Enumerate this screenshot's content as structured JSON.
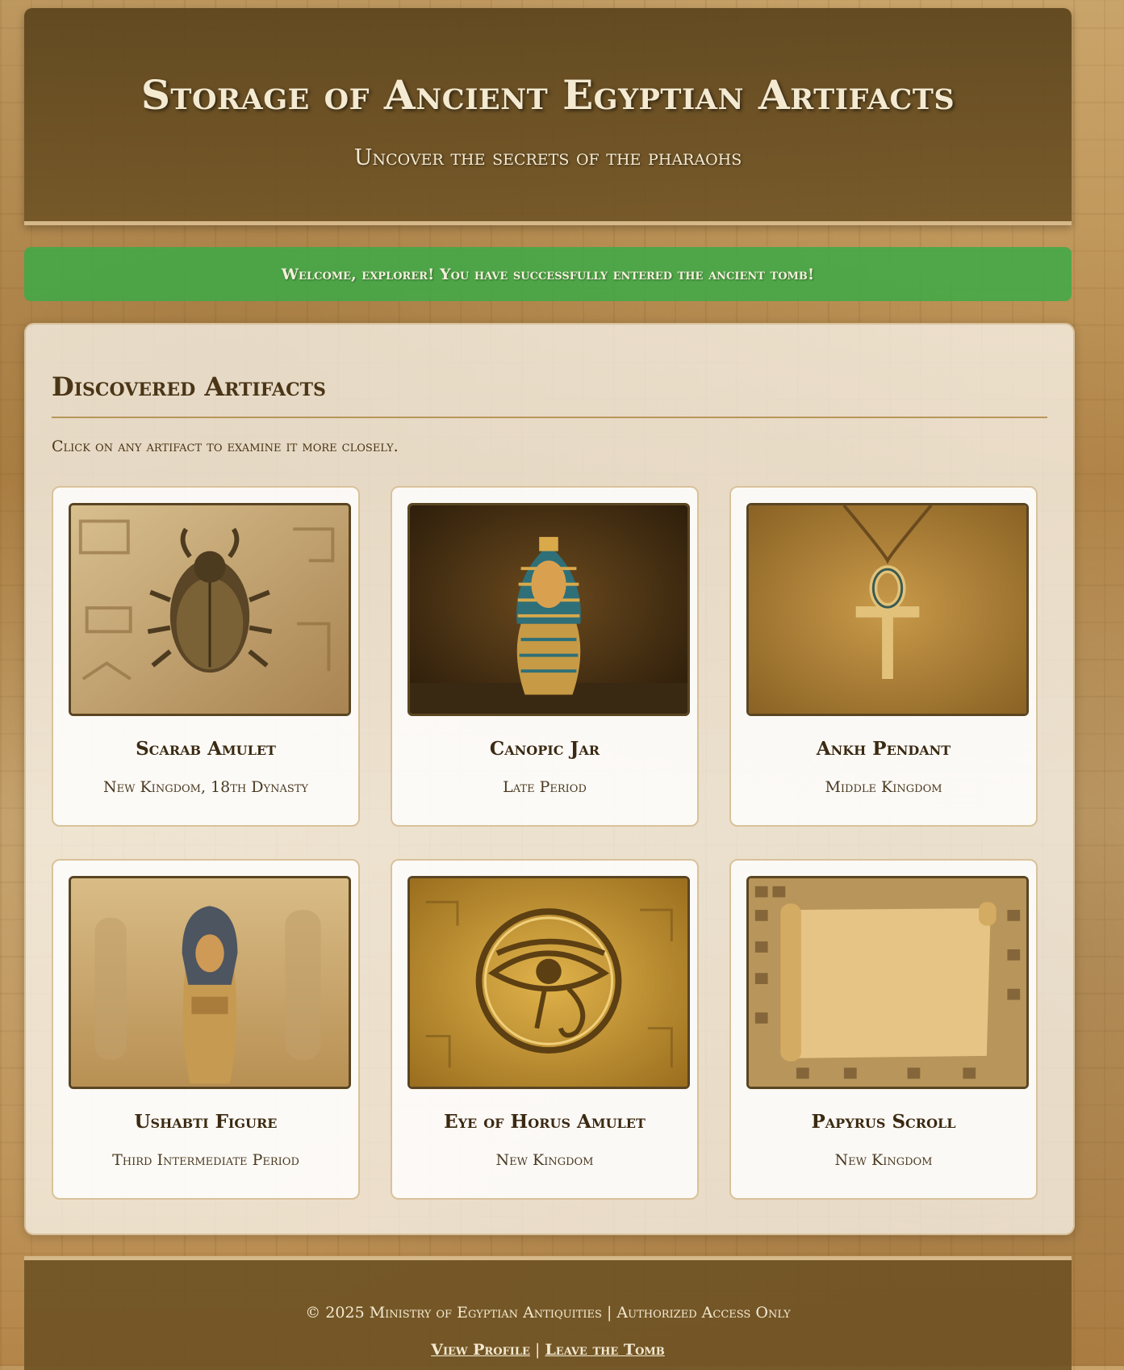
{
  "header": {
    "title": "Storage of Ancient Egyptian Artifacts",
    "subtitle": "Uncover the secrets of the pharaohs"
  },
  "alert": {
    "message": "Welcome, explorer! You have successfully entered the ancient tomb!"
  },
  "main": {
    "heading": "Discovered Artifacts",
    "hint": "Click on any artifact to examine it more closely.",
    "artifacts": [
      {
        "name": "Scarab Amulet",
        "era": "New Kingdom, 18th Dynasty",
        "image": "scarab-beetle"
      },
      {
        "name": "Canopic Jar",
        "era": "Late Period",
        "image": "pharaoh-head-jar"
      },
      {
        "name": "Ankh Pendant",
        "era": "Middle Kingdom",
        "image": "ankh-necklace"
      },
      {
        "name": "Ushabti Figure",
        "era": "Third Intermediate Period",
        "image": "ushabti-statue"
      },
      {
        "name": "Eye of Horus Amulet",
        "era": "New Kingdom",
        "image": "eye-of-horus"
      },
      {
        "name": "Papyrus Scroll",
        "era": "New Kingdom",
        "image": "papyrus-scroll"
      }
    ]
  },
  "footer": {
    "copyright": "© 2025 Ministry of Egyptian Antiquities | Authorized Access Only",
    "view_profile": "View Profile",
    "separator": "|",
    "leave": "Leave the Tomb"
  }
}
